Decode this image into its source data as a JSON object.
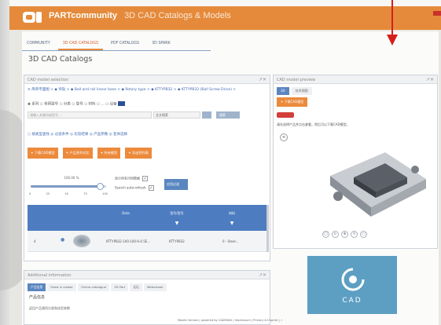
{
  "header": {
    "brand_bold": "PARTcommunity",
    "brand_sub": "3D CAD Catalogs & Models"
  },
  "nav": {
    "tabs": [
      "COMMUNITY",
      "3D CAD CATALOGS",
      "PDF CATALOGS",
      "3D SPARK"
    ],
    "active_index": 1
  },
  "page": {
    "title": "3D CAD Catalogs"
  },
  "selection_panel": {
    "title": "CAD model selection",
    "breadcrumb": "≡ 简单平面图 > ◆ 导轨 > ◆ Ball and rail linear base > ◆ Rotary type > ◆ KTTYPB32 > ◆ KTTYPB32 (Ball Screw Drive) >",
    "radios_text": "◉ 系列  ○ 常用型号 ○ 分类  ○ 型号  ○ 材料   ○ …  ○ 设备",
    "search_placeholder": "请输入关键词或型号…",
    "search_mode": "全文搜索",
    "search_button": "搜索",
    "options_text": "○ 按类型查找 ◎ 过滤条件  ◎ 比较结果  ◎ 产品参数  ◎ 变体选择",
    "action_buttons": [
      "✦ 下载CAD模型",
      "✦ 产品系列对比",
      "✦ 所有模型",
      "✦ 导出到列表"
    ],
    "slider_label": "100.00 %",
    "slider_value": 0.92,
    "slider_ticks": [
      "0",
      "25",
      "50",
      "75",
      "100"
    ],
    "check_1": "显示所有可用数据",
    "check_2": "Search auto-refresh",
    "apply_button": "应用过滤",
    "table": {
      "headers": [
        "Data",
        "型号/型号",
        "材料"
      ],
      "row": {
        "index": "4",
        "name": "KTTYPB32-100-100-6-0.5E...",
        "model": "KTTYPB32",
        "material": "0 - Steel..."
      }
    }
  },
  "preview_panel": {
    "title": "CAD model preview",
    "tabs": [
      "3D",
      "技术视图"
    ],
    "download_button": "✦ 下载CAD模型",
    "description": "请先选择产品并点击查看，然后可以下载CAD模型。",
    "list_icon": "list-icon",
    "view_icons": [
      "3d-view-icon",
      "rotate-icon",
      "move-icon",
      "zoom-icon",
      "fit-icon"
    ]
  },
  "additional_panel": {
    "title": "Additional information",
    "tabs": [
      "产品信息",
      "Show in viewer",
      "Online catalogue",
      "3D Part",
      "论坛",
      "Webviewer"
    ],
    "heading": "产品信息",
    "subtext": "返回产品通用分类和选型参数"
  },
  "cad_logo": {
    "text": "CAD"
  },
  "footer": {
    "text": "Mobile Version | powered by CADENAS | Impressum | Privacy & Imprint | ☆"
  },
  "colors": {
    "header_orange": "#e58a3a",
    "button_orange": "#ec8a3c",
    "table_blue": "#4d7cc0",
    "accent_red": "#d4201c",
    "cad_blue": "#5d9fc3"
  }
}
